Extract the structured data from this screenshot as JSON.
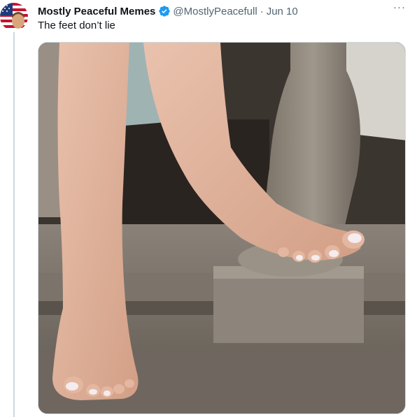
{
  "tweet": {
    "display_name": "Mostly Peaceful Memes",
    "handle": "@MostlyPeacefull",
    "separator": "·",
    "date": "Jun 10",
    "text": "The feet don’t lie",
    "more_label": "···",
    "verified": true
  },
  "media": {
    "kind": "photo",
    "icon": "photo-feet-on-stone-balustrade"
  },
  "colors": {
    "verified_blue": "#1d9bf0",
    "secondary_text": "#536471",
    "primary_text": "#0f1419",
    "border": "#cfd9de"
  }
}
